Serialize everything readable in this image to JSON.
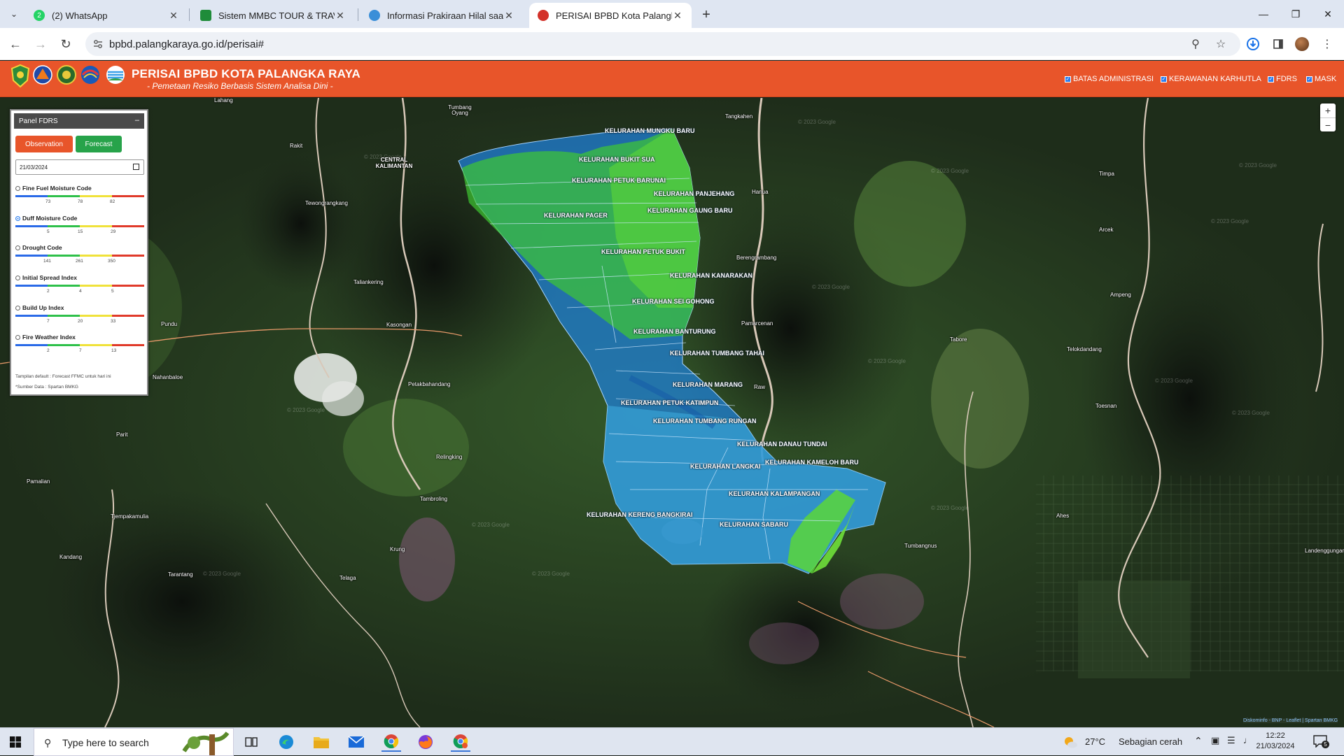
{
  "browser": {
    "tabs": [
      {
        "title": "(2) WhatsApp",
        "close": "✕",
        "favicon_badge": "2",
        "favicon_color": "#25d366"
      },
      {
        "title": "Sistem MMBC TOUR & TRAVEL",
        "close": "✕",
        "favicon_color": "#1f8c3a"
      },
      {
        "title": "Informasi Prakiraan Hilal saat M",
        "close": "✕",
        "favicon_color": "#3a8fd8"
      },
      {
        "title": "PERISAI BPBD Kota Palangka Ra",
        "close": "✕",
        "favicon_color": "#d3322a"
      }
    ],
    "new_tab": "+",
    "url": "bpbd.palangkaraya.go.id/perisai#"
  },
  "site": {
    "title": "PERISAI BPBD KOTA PALANGKA RAYA",
    "subtitle": "- Pemetaan Resiko Berbasis Sistem Analisa Dini -",
    "layers": [
      {
        "label": "BATAS ADMINISTRASI",
        "checked": true
      },
      {
        "label": "KERAWANAN KARHUTLA",
        "checked": true
      },
      {
        "label": "FDRS",
        "checked": true
      },
      {
        "label": "MASK",
        "checked": true
      }
    ]
  },
  "panel": {
    "title": "Panel FDRS",
    "minimize": "–",
    "observation": "Observation",
    "forecast": "Forecast",
    "date": "21/03/2024",
    "indices": [
      {
        "name": "Fine Fuel Moisture Code",
        "selected": false,
        "ticks": [
          "73",
          "78",
          "82"
        ]
      },
      {
        "name": "Duff Moisture Code",
        "selected": true,
        "ticks": [
          "5",
          "15",
          "29"
        ]
      },
      {
        "name": "Drought Code",
        "selected": false,
        "ticks": [
          "141",
          "261",
          "350"
        ]
      },
      {
        "name": "Initial Spread Index",
        "selected": false,
        "ticks": [
          "2",
          "4",
          "5"
        ]
      },
      {
        "name": "Build Up Index",
        "selected": false,
        "ticks": [
          "7",
          "20",
          "33"
        ]
      },
      {
        "name": "Fire Weather Index",
        "selected": false,
        "ticks": [
          "2",
          "7",
          "13"
        ]
      }
    ],
    "note1": "Tampilan default : Forecast FFMC untuk hari ini",
    "note2": "*Sumber Data : Spartan BMKG",
    "scale_colors": [
      "#2a6ae8",
      "#2ec04a",
      "#f0e23a",
      "#e03a2a"
    ]
  },
  "map": {
    "kelurahan": [
      {
        "name": "KELURAHAN MUNGKU BARU"
      },
      {
        "name": "KELURAHAN BUKIT SUA"
      },
      {
        "name": "KELURAHAN PETUK BARUNAI"
      },
      {
        "name": "KELURAHAN PANJEHANG"
      },
      {
        "name": "KELURAHAN GAUNG BARU"
      },
      {
        "name": "KELURAHAN PAGER"
      },
      {
        "name": "KELURAHAN PETUK BUKIT"
      },
      {
        "name": "KELURAHAN KANARAKAN"
      },
      {
        "name": "KELURAHAN SEI GOHONG"
      },
      {
        "name": "KELURAHAN BANTURUNG"
      },
      {
        "name": "KELURAHAN TUMBANG TAHAI"
      },
      {
        "name": "KELURAHAN MARANG"
      },
      {
        "name": "KELURAHAN PETUK KATIMPUN"
      },
      {
        "name": "KELURAHAN TUMBANG RUNGAN"
      },
      {
        "name": "KELURAHAN DANAU TUNDAI"
      },
      {
        "name": "KELURAHAN LANGKAI"
      },
      {
        "name": "KELURAHAN KAMELOH BARU"
      },
      {
        "name": "KELURAHAN KALAMPANGAN"
      },
      {
        "name": "KELURAHAN KERENG BANGKIRAI"
      },
      {
        "name": "KELURAHAN SABARU"
      }
    ],
    "places": [
      {
        "name": "Lahang"
      },
      {
        "name": "Tumbang Oyang"
      },
      {
        "name": "Tangkahen"
      },
      {
        "name": "Rakit"
      },
      {
        "name": "CENTRAL KALIMANTAN"
      },
      {
        "name": "Tewongrangkang"
      },
      {
        "name": "Timpa"
      },
      {
        "name": "Hanua"
      },
      {
        "name": "Arcek"
      },
      {
        "name": "Berengrambang"
      },
      {
        "name": "Taliankering"
      },
      {
        "name": "Pundu"
      },
      {
        "name": "Kasongan"
      },
      {
        "name": "Ampeng"
      },
      {
        "name": "Pamarcenan"
      },
      {
        "name": "Tabore"
      },
      {
        "name": "Telokdandang"
      },
      {
        "name": "Nahanbaloe"
      },
      {
        "name": "Petakbahandang"
      },
      {
        "name": "Raw"
      },
      {
        "name": "Toesnan"
      },
      {
        "name": "Parit"
      },
      {
        "name": "Relingking"
      },
      {
        "name": "Pamalian"
      },
      {
        "name": "Tambroling"
      },
      {
        "name": "Tjempakamulia"
      },
      {
        "name": "Ahes"
      },
      {
        "name": "Kandang"
      },
      {
        "name": "Krung"
      },
      {
        "name": "Tumbangnus"
      },
      {
        "name": "Landenggungan"
      },
      {
        "name": "Tarantang"
      },
      {
        "name": "Telaga"
      }
    ],
    "watermark": "© 2023 Google",
    "attribution": "Diskominfo - BNP - Leaflet | Spartan BMKG",
    "zoom_in": "+",
    "zoom_out": "−"
  },
  "taskbar": {
    "search_placeholder": "Type here to search",
    "temperature": "27°C",
    "weather": "Sebagian cerah",
    "time": "12:22",
    "date": "21/03/2024",
    "notifications": "5"
  }
}
